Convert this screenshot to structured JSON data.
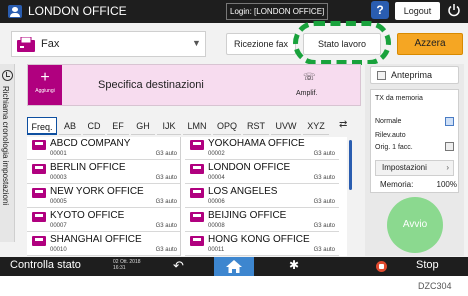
{
  "topbar": {
    "title": "LONDON OFFICE",
    "login": "Login: [LONDON OFFICE]",
    "help": "?",
    "logout": "Logout"
  },
  "app": {
    "label": "Fax",
    "ricezione": "Ricezione fax",
    "stato": "Stato lavoro",
    "azzera": "Azzera"
  },
  "side_tab": {
    "label": "Richiama cronologia impostazioni"
  },
  "dest": {
    "add_label": "Aggiungi",
    "specifica": "Specifica destinazioni",
    "amplif": "Amplif."
  },
  "tabs": [
    "Freq.",
    "AB",
    "CD",
    "EF",
    "GH",
    "IJK",
    "LMN",
    "OPQ",
    "RST",
    "UVW",
    "XYZ"
  ],
  "entries": [
    {
      "name": "ABCD COMPANY",
      "num": "00001",
      "mode": "G3 auto"
    },
    {
      "name": "YOKOHAMA OFFICE",
      "num": "00002",
      "mode": "G3 auto"
    },
    {
      "name": "BERLIN OFFICE",
      "num": "00003",
      "mode": "G3 auto"
    },
    {
      "name": "LONDON OFFICE",
      "num": "00004",
      "mode": "G3 auto"
    },
    {
      "name": "NEW YORK OFFICE",
      "num": "00005",
      "mode": "G3 auto"
    },
    {
      "name": "LOS ANGELES",
      "num": "00006",
      "mode": "G3 auto"
    },
    {
      "name": "KYOTO OFFICE",
      "num": "00007",
      "mode": "G3 auto"
    },
    {
      "name": "BEIJING OFFICE",
      "num": "00008",
      "mode": "G3 auto"
    },
    {
      "name": "SHANGHAI  OFFICE",
      "num": "00010",
      "mode": "G3 auto"
    },
    {
      "name": "HONG KONG OFFICE",
      "num": "00011",
      "mode": "G3 auto"
    }
  ],
  "right": {
    "anteprima": "Anteprima",
    "tx": "TX da memoria",
    "normale": "Normale",
    "rilev": "Rilev.auto",
    "orig": "Orig. 1 facc.",
    "impostazioni": "Impostazioni",
    "memoria_label": "Memoria:",
    "memoria_value": "100%",
    "avvio": "Avvio"
  },
  "bottombar": {
    "controlla": "Controlla stato",
    "date": "02 Ott. 2018",
    "time": "16:31",
    "stop": "Stop"
  },
  "code": "DZC304"
}
